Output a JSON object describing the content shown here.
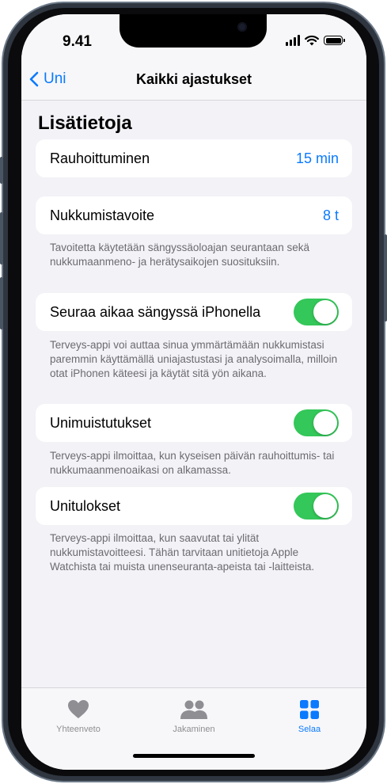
{
  "status": {
    "time": "9.41"
  },
  "nav": {
    "back_label": "Uni",
    "title": "Kaikki ajastukset"
  },
  "section_title": "Lisätietoja",
  "rows": {
    "wind_down": {
      "label": "Rauhoittuminen",
      "value": "15 min"
    },
    "sleep_goal": {
      "label": "Nukkumistavoite",
      "value": "8 t",
      "note": "Tavoitetta käytetään sängyssäoloajan seurantaan sekä nukkumaanmeno- ja herätysaikojen suosituksiin."
    },
    "track_iphone": {
      "label": "Seuraa aikaa sängyssä iPhonella",
      "enabled": true,
      "note": "Terveys-appi voi auttaa sinua ymmärtämään nukkumistasi paremmin käyttämällä uniajastustasi ja analysoimalla, milloin otat iPhonen käteesi ja käytät sitä yön aikana."
    },
    "sleep_reminders": {
      "label": "Unimuistutukset",
      "enabled": true,
      "note": "Terveys-appi ilmoittaa, kun kyseisen päivän rauhoittumis- tai nukkumaanmenoaikasi on alkamassa."
    },
    "sleep_results": {
      "label": "Unitulokset",
      "enabled": true,
      "note": "Terveys-appi ilmoittaa, kun saavutat tai ylität nukkumistavoitteesi. Tähän tarvitaan unitietoja Apple Watchista tai muista unenseuranta-apeista tai -laitteista."
    }
  },
  "tabbar": {
    "tabs": [
      {
        "label": "Yhteenveto",
        "icon": "heart-icon",
        "active": false
      },
      {
        "label": "Jakaminen",
        "icon": "people-icon",
        "active": false
      },
      {
        "label": "Selaa",
        "icon": "grid-icon",
        "active": true
      }
    ]
  },
  "colors": {
    "accent": "#0a7aff",
    "toggle_on": "#34c759",
    "background": "#f2f2f7"
  }
}
